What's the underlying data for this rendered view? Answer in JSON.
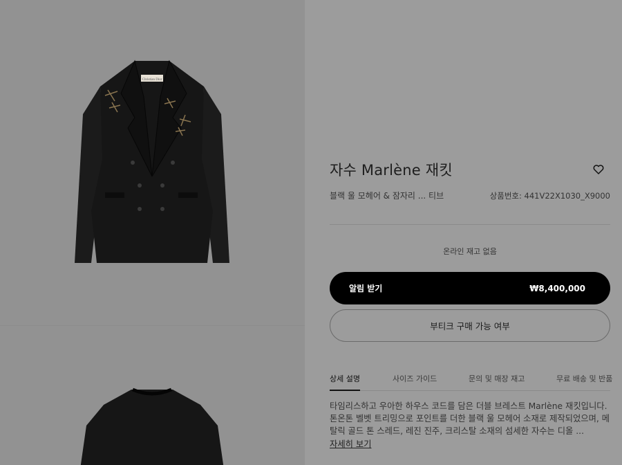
{
  "product": {
    "title": "자수 Marlène 재킷",
    "subtitle": "블랙 울 모헤어 & 잠자리 ... 티브",
    "reference": "상품번호: 441V22X1030_X9000",
    "stock_status": "온라인 재고 없음",
    "notify_label": "알림 받기",
    "price": "₩8,400,000",
    "boutique_label": "부티크 구매 가능 여부",
    "description": "타임리스하고 우아한 하우스 코드를 담은 더블 브레스트 Marlène 재킷입니다. 톤온톤 벨벳 트리밍으로 포인트를 더한 블랙 울 모헤어 소재로 제작되었으며, 메탈릭 골드 톤 스레드, 레진 진주, 크리스탈 소재의 섬세한 자수는 디올 ...",
    "more_label": "자세히 보기"
  },
  "tabs": [
    {
      "label": "상세 설명",
      "active": true
    },
    {
      "label": "사이즈 가이드",
      "active": false
    },
    {
      "label": "문의 및 매장 재고",
      "active": false
    },
    {
      "label": "무료 배송 및 반품",
      "active": false
    }
  ],
  "gallery": {
    "label_text": "Christian Dior"
  },
  "icons": {
    "wishlist": "heart-icon"
  },
  "colors": {
    "primary_button": "#000000",
    "overlay": "#9a9a9a"
  }
}
